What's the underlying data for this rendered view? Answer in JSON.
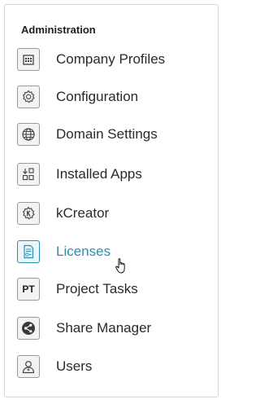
{
  "section": {
    "title": "Administration"
  },
  "items": [
    {
      "label": "Company Profiles",
      "icon": "building-icon"
    },
    {
      "label": "Configuration",
      "icon": "gear-icon"
    },
    {
      "label": "Domain Settings",
      "icon": "globe-icon"
    },
    {
      "label": "Installed Apps",
      "icon": "apps-icon"
    },
    {
      "label": "kCreator",
      "icon": "kcreator-gear-icon"
    },
    {
      "label": "Licenses",
      "icon": "license-document-icon",
      "active": true
    },
    {
      "label": "Project Tasks",
      "icon": "pt-icon",
      "icon_text": "PT"
    },
    {
      "label": "Share Manager",
      "icon": "share-icon"
    },
    {
      "label": "Users",
      "icon": "user-icon"
    }
  ],
  "colors": {
    "active": "#2a8fb3",
    "text": "#2a2a2a",
    "border": "#9a9a9a"
  }
}
